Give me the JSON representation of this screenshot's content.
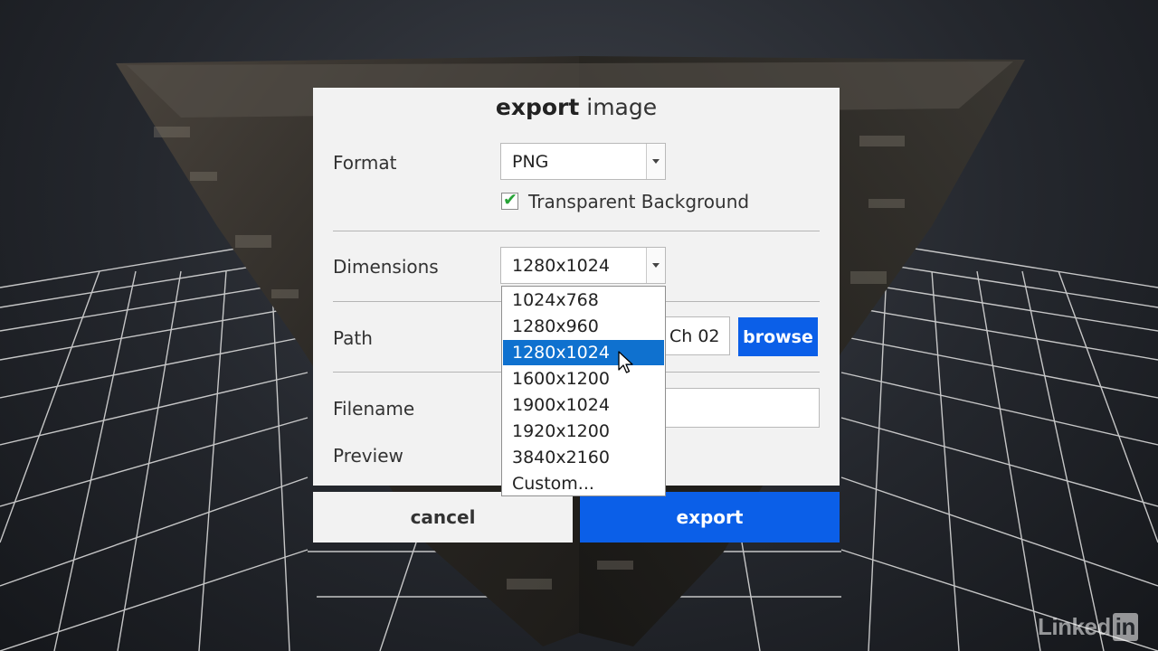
{
  "dialog": {
    "title_bold": "export",
    "title_rest": " image",
    "format": {
      "label": "Format",
      "value": "PNG"
    },
    "transparent_background": {
      "label": "Transparent Background",
      "checked": true
    },
    "dimensions": {
      "label": "Dimensions",
      "value": "1280x1024",
      "options": [
        "1024x768",
        "1280x960",
        "1280x1024",
        "1600x1200",
        "1900x1024",
        "1920x1200",
        "3840x2160",
        "Custom..."
      ],
      "highlighted": "1280x1024"
    },
    "path": {
      "label": "Path",
      "value": "Ch 02",
      "browse_label": "browse"
    },
    "filename": {
      "label": "Filename",
      "value": ""
    },
    "preview": {
      "label": "Preview"
    },
    "cancel_label": "cancel",
    "export_label": "export"
  },
  "watermark": {
    "text": "Linked",
    "badge": "in"
  },
  "colors": {
    "accent": "#0b5fe8",
    "selection": "#0f71cf",
    "check": "#27a337"
  }
}
